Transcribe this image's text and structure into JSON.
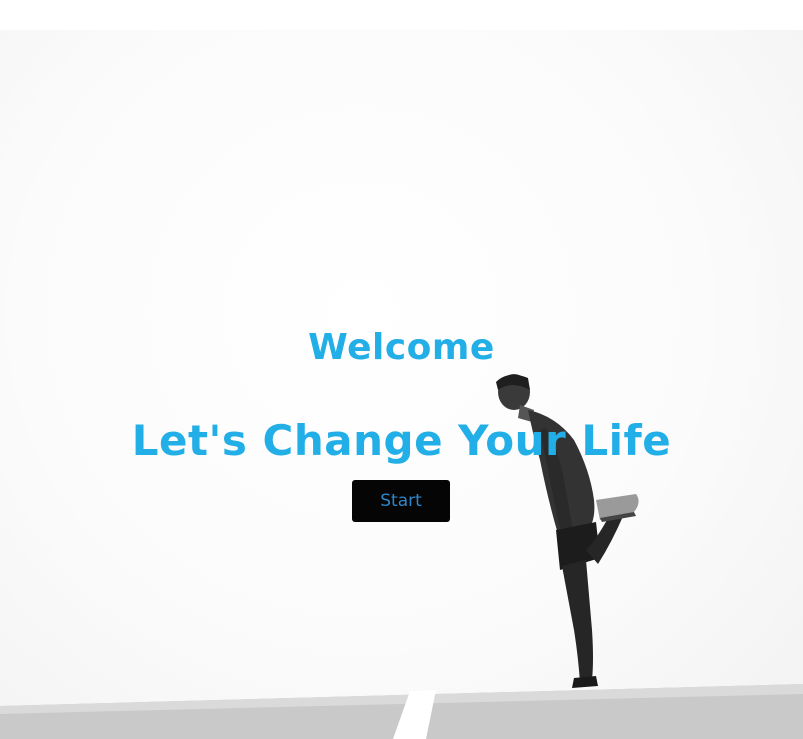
{
  "hero": {
    "title": "Welcome",
    "tagline": "Let's Change Your Life",
    "start_label": "Start",
    "background_image": "man-stretching-photo",
    "colors": {
      "text": "#22aee6",
      "button_bg": "#050505",
      "button_text": "#2f86c9"
    }
  }
}
